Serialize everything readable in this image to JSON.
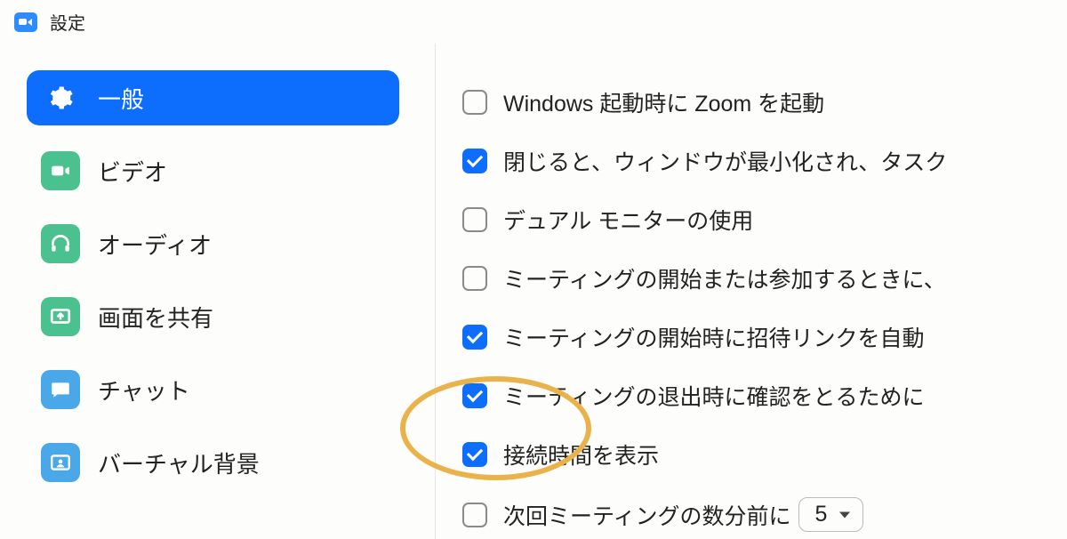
{
  "window": {
    "title": "設定"
  },
  "sidebar": {
    "items": [
      {
        "label": "一般",
        "icon": "gear-icon",
        "active": true
      },
      {
        "label": "ビデオ",
        "icon": "video-icon",
        "active": false
      },
      {
        "label": "オーディオ",
        "icon": "headphones-icon",
        "active": false
      },
      {
        "label": "画面を共有",
        "icon": "share-screen-icon",
        "active": false
      },
      {
        "label": "チャット",
        "icon": "chat-icon",
        "active": false
      },
      {
        "label": "バーチャル背景",
        "icon": "virtual-bg-icon",
        "active": false
      }
    ]
  },
  "settings": {
    "items": [
      {
        "label": "Windows 起動時に Zoom を起動",
        "checked": false
      },
      {
        "label": "閉じると、ウィンドウが最小化され、タスク",
        "checked": true
      },
      {
        "label": "デュアル モニターの使用",
        "checked": false
      },
      {
        "label": "ミーティングの開始または参加するときに、",
        "checked": false
      },
      {
        "label": "ミーティングの開始時に招待リンクを自動",
        "checked": true
      },
      {
        "label": "ミーティングの退出時に確認をとるために",
        "checked": true
      },
      {
        "label": "接続時間を表示",
        "checked": true
      },
      {
        "label": "次回ミーティングの数分前に",
        "checked": false,
        "select_value": "5"
      }
    ]
  },
  "colors": {
    "primary": "#0d6efd",
    "sidebar_icon_green": "#4ac18e",
    "sidebar_icon_blue": "#4aa7e8",
    "highlight_ring": "#eab24a"
  }
}
